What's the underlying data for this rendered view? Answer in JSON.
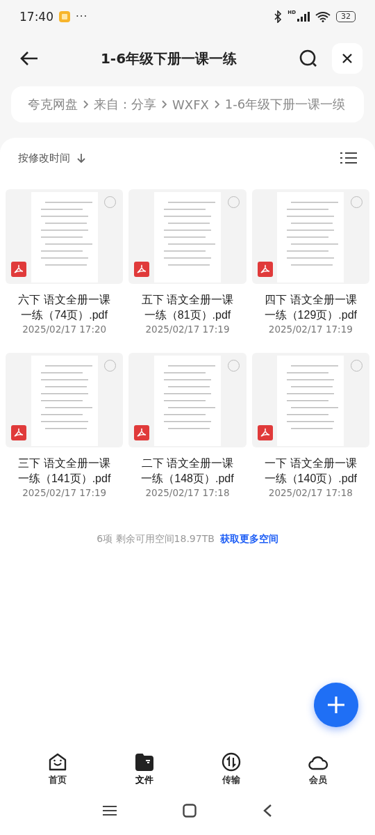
{
  "status_bar": {
    "time": "17:40",
    "more": "···",
    "network": "HD",
    "battery": "32"
  },
  "header": {
    "title": "1-6年级下册一课一练"
  },
  "breadcrumb": [
    "夸克网盘",
    "来自：分享",
    "WXFX",
    "1-6年级下册一课一绬"
  ],
  "sort": {
    "label": "按修改时间"
  },
  "files": [
    {
      "name": "六下 语文全册一课一练（74页）.pdf",
      "date": "2025/02/17 17:20",
      "selected": false
    },
    {
      "name": "五下 语文全册一课一练（81页）.pdf",
      "date": "2025/02/17 17:19",
      "selected": false
    },
    {
      "name": "四下 语文全册一课一练（129页）.pdf",
      "date": "2025/02/17 17:19",
      "selected": false
    },
    {
      "name": "三下 语文全册一课一练（141页）.pdf",
      "date": "2025/02/17 17:19",
      "selected": false
    },
    {
      "name": "二下 语文全册一课一练（148页）.pdf",
      "date": "2025/02/17 17:18",
      "selected": false
    },
    {
      "name": "一下 语文全册一课一练（140页）.pdf",
      "date": "2025/02/17 17:18",
      "selected": false
    }
  ],
  "summary": {
    "text": "6项 剩余可用空间18.97TB",
    "link": "获取更多空间"
  },
  "tabs": [
    {
      "kind": "home",
      "label": "首页",
      "selected": false
    },
    {
      "kind": "files",
      "label": "文件",
      "selected": true
    },
    {
      "kind": "transfer",
      "label": "传输",
      "selected": false
    },
    {
      "kind": "member",
      "label": "会员",
      "selected": false
    }
  ]
}
